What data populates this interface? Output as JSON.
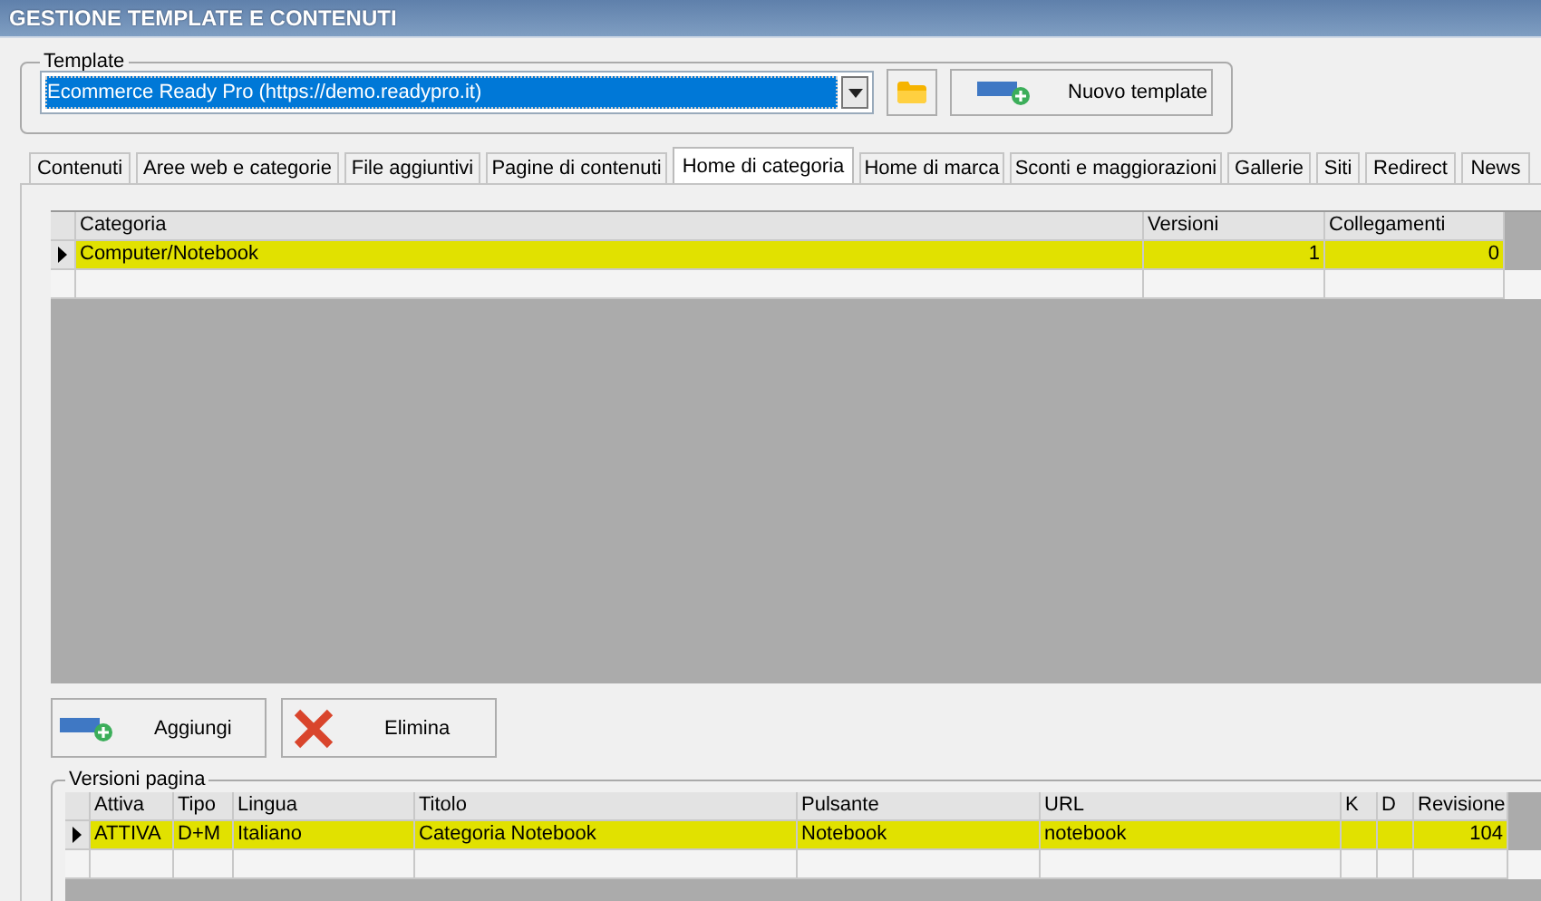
{
  "window": {
    "title": "GESTIONE TEMPLATE E CONTENUTI"
  },
  "template": {
    "label": "Template",
    "value": "Ecommerce Ready Pro (https://demo.readypro.it)",
    "new_button": "Nuovo template"
  },
  "tabs": [
    {
      "label": "Contenuti",
      "selected": false
    },
    {
      "label": "Aree web e categorie",
      "selected": false
    },
    {
      "label": "File aggiuntivi",
      "selected": false
    },
    {
      "label": "Pagine di contenuti",
      "selected": false
    },
    {
      "label": "Home di categoria",
      "selected": true
    },
    {
      "label": "Home di marca",
      "selected": false
    },
    {
      "label": "Sconti e maggiorazioni",
      "selected": false
    },
    {
      "label": "Gallerie",
      "selected": false
    },
    {
      "label": "Siti",
      "selected": false
    },
    {
      "label": "Redirect",
      "selected": false
    },
    {
      "label": "News",
      "selected": false
    }
  ],
  "categories_table": {
    "columns": [
      {
        "label": "Categoria",
        "kind": "text"
      },
      {
        "label": "Versioni",
        "kind": "number"
      },
      {
        "label": "Collegamenti",
        "kind": "number"
      }
    ],
    "rows": [
      {
        "selected": true,
        "cells": [
          "Computer/Notebook",
          "1",
          "0"
        ]
      }
    ]
  },
  "buttons": [
    {
      "label": "Aggiungi",
      "kind": "add"
    },
    {
      "label": "Elimina",
      "kind": "delete"
    }
  ],
  "versions": {
    "label": "Versioni pagina",
    "columns": [
      {
        "label": "Attiva",
        "kind": "text"
      },
      {
        "label": "Tipo",
        "kind": "text"
      },
      {
        "label": "Lingua",
        "kind": "text"
      },
      {
        "label": "Titolo",
        "kind": "text"
      },
      {
        "label": "Pulsante",
        "kind": "text"
      },
      {
        "label": "URL",
        "kind": "text"
      },
      {
        "label": "K",
        "kind": "text"
      },
      {
        "label": "D",
        "kind": "text"
      },
      {
        "label": "Revisione",
        "kind": "number"
      }
    ],
    "rows": [
      {
        "selected": true,
        "cells": [
          "ATTIVA",
          "D+M",
          "Italiano",
          "Categoria Notebook",
          "Notebook",
          "notebook",
          null,
          null,
          "104"
        ]
      }
    ]
  }
}
